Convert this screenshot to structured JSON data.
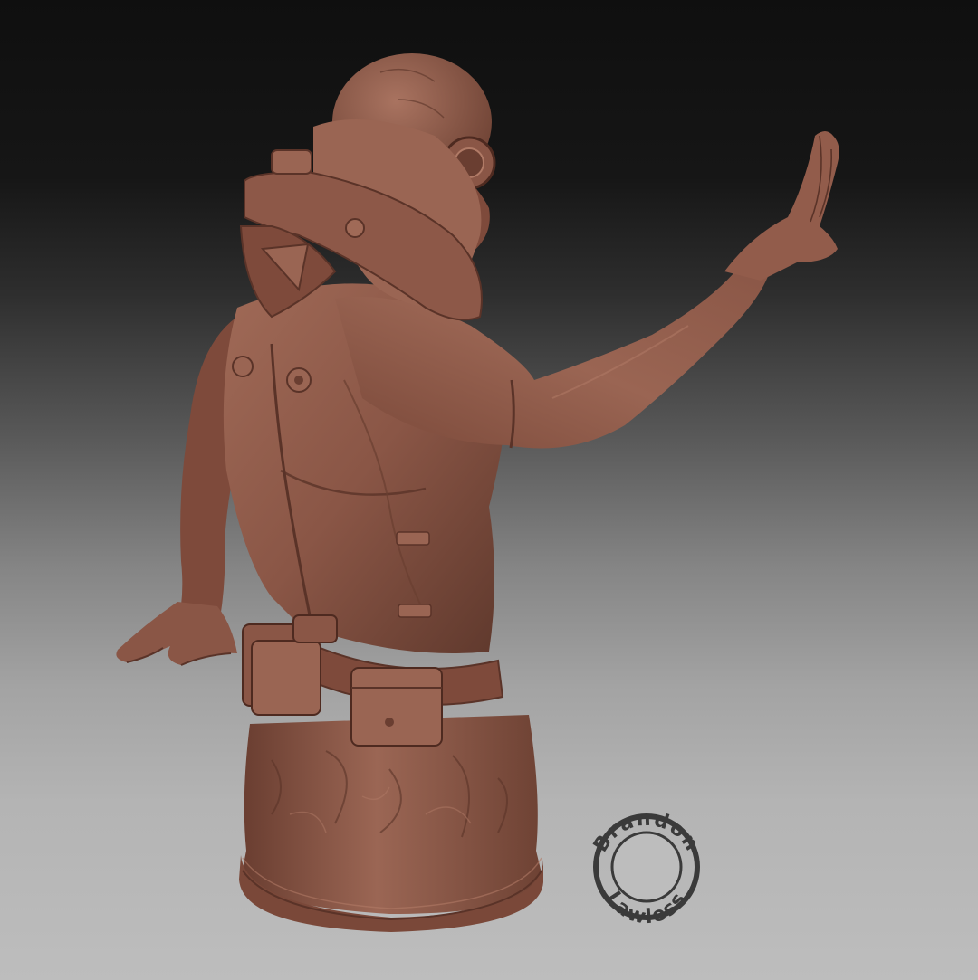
{
  "image": {
    "subject": "clay-render-sculpted-bust",
    "palette": {
      "clay_base": "#8a5646",
      "clay_light": "#b07a66",
      "clay_dark": "#5a3328",
      "clay_shadow": "#3e2119",
      "background_top": "#0f0f0f",
      "background_bottom": "#bdbdbd"
    }
  },
  "watermark": {
    "line1": "Brandon",
    "line2": "Lawless",
    "ring_color": "#3a3a3a",
    "text_color": "#3a3a3a"
  }
}
